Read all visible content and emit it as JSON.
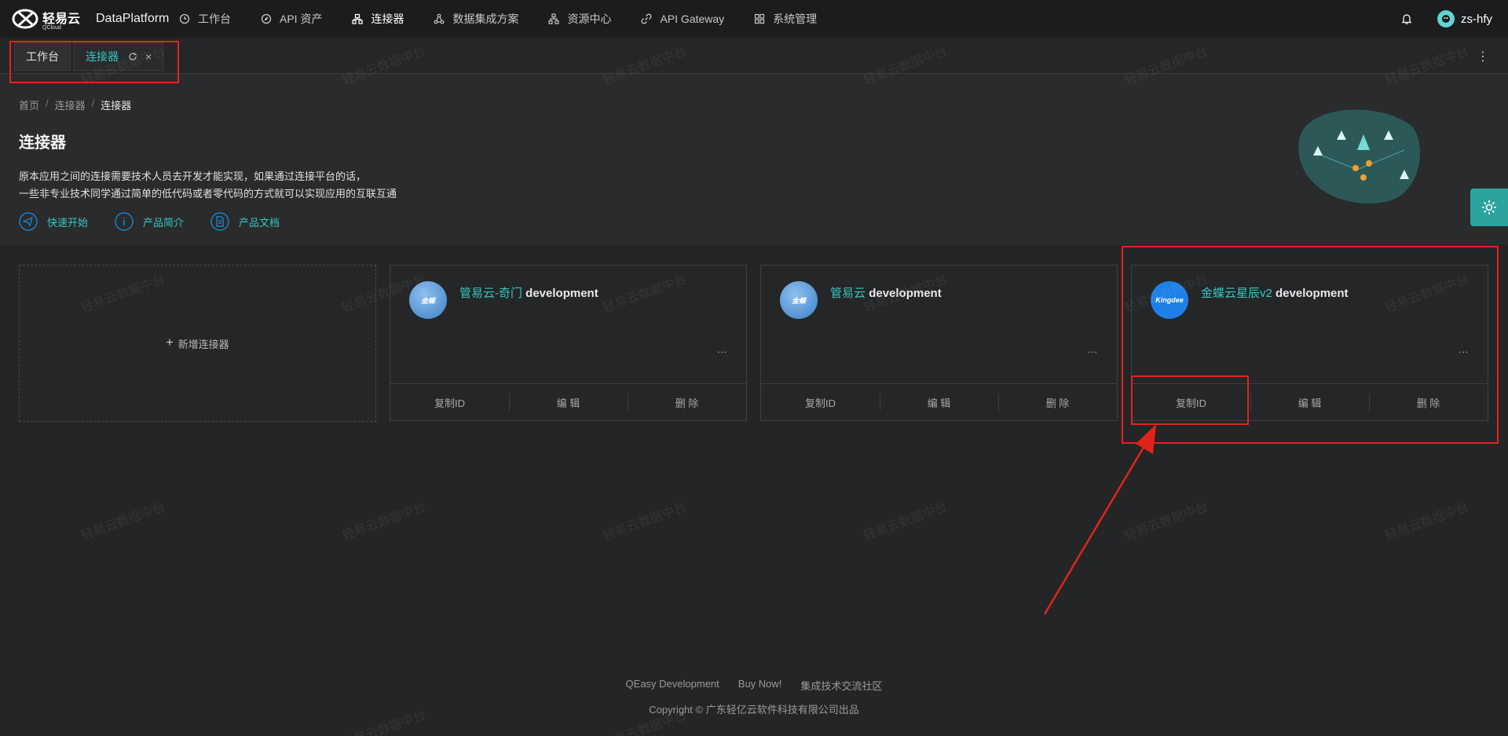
{
  "header": {
    "logo_text": "轻易云",
    "logo_sub": "QCloud",
    "app_name": "DataPlatform",
    "nav": [
      {
        "label": "工作台",
        "icon": "clock-icon"
      },
      {
        "label": "API 资产",
        "icon": "compass-icon"
      },
      {
        "label": "连接器",
        "icon": "connector-icon",
        "active": true
      },
      {
        "label": "数据集成方案",
        "icon": "network-icon"
      },
      {
        "label": "资源中心",
        "icon": "hierarchy-icon"
      },
      {
        "label": "API Gateway",
        "icon": "link-icon"
      },
      {
        "label": "系统管理",
        "icon": "grid-icon"
      }
    ],
    "username": "zs-hfy"
  },
  "tabs": [
    {
      "label": "工作台"
    },
    {
      "label": "连接器",
      "active": true,
      "close": "×"
    }
  ],
  "kebab": "⋮",
  "breadcrumb": {
    "home": "首页",
    "sep": "/",
    "level1": "连接器",
    "current": "连接器"
  },
  "page": {
    "title": "连接器",
    "desc_line1": "原本应用之间的连接需要技术人员去开发才能实现，如果通过连接平台的话，",
    "desc_line2": "一些非专业技术同学通过简单的低代码或者零代码的方式就可以实现应用的互联互通"
  },
  "quicklinks": [
    {
      "label": "快速开始",
      "icon": "paper-plane-icon"
    },
    {
      "label": "产品简介",
      "icon": "info-icon"
    },
    {
      "label": "产品文档",
      "icon": "document-icon"
    }
  ],
  "add_card": {
    "plus": "+",
    "label": "新增连接器"
  },
  "cards": [
    {
      "title_cn": "管易云-奇门",
      "title_en": "development",
      "logo_text": "金蝶",
      "logo_color": "#5b9bd5",
      "dots": "...",
      "actions": [
        "复制ID",
        "编 辑",
        "删 除"
      ]
    },
    {
      "title_cn": "管易云",
      "title_en": "development",
      "logo_text": "金蝶",
      "logo_color": "#5b9bd5",
      "dots": "...",
      "actions": [
        "复制ID",
        "编 辑",
        "删 除"
      ]
    },
    {
      "title_cn": "金蝶云星辰v2",
      "title_en": "development",
      "logo_text": "Kingdee",
      "logo_color": "#1e7fe8",
      "dots": "...",
      "actions": [
        "复制ID",
        "编 辑",
        "删 除"
      ]
    }
  ],
  "watermark": "轻易云数据中台",
  "footer": {
    "links": [
      "QEasy Development",
      "Buy Now!",
      "集成技术交流社区"
    ],
    "copyright": "Copyright © 广东轻亿云软件科技有限公司出品"
  },
  "colors": {
    "accent": "#36c6c1",
    "annotation": "#e0241d",
    "background": "#2a2b2c"
  }
}
